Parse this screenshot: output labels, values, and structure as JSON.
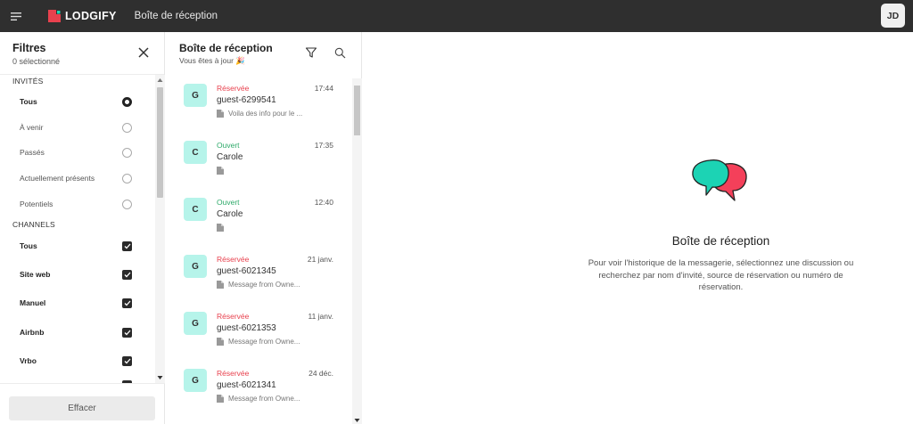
{
  "header": {
    "brand": "LODGIFY",
    "page_title": "Boîte de réception",
    "user_initials": "JD"
  },
  "colors": {
    "topbar": "#2f2f2f",
    "brand_red": "#e8414e",
    "brand_teal": "#1cd3b4",
    "status_reserved": "#e8414e",
    "status_open": "#2eaa6a",
    "avatar_bg": "#b6f4ea"
  },
  "filters": {
    "title": "Filtres",
    "selected_count": "0 sélectionné",
    "guests_section": "INVITÉS",
    "guests": [
      {
        "label": "Tous",
        "selected": true
      },
      {
        "label": "À venir",
        "selected": false
      },
      {
        "label": "Passés",
        "selected": false
      },
      {
        "label": "Actuellement présents",
        "selected": false
      },
      {
        "label": "Potentiels",
        "selected": false
      }
    ],
    "channels_section": "CHANNELS",
    "channels": [
      {
        "label": "Tous",
        "checked": true
      },
      {
        "label": "Site web",
        "checked": true
      },
      {
        "label": "Manuel",
        "checked": true
      },
      {
        "label": "Airbnb",
        "checked": true
      },
      {
        "label": "Vrbo",
        "checked": true
      }
    ],
    "clear_button": "Effacer"
  },
  "inbox": {
    "title": "Boîte de réception",
    "subtitle": "Vous êtes à jour 🎉",
    "conversations": [
      {
        "initial": "G",
        "status": "Réservée",
        "status_type": "reserved",
        "time": "17:44",
        "name": "guest-6299541",
        "preview": "Voila des info pour le ..."
      },
      {
        "initial": "C",
        "status": "Ouvert",
        "status_type": "open",
        "time": "17:35",
        "name": "Carole",
        "preview": ""
      },
      {
        "initial": "C",
        "status": "Ouvert",
        "status_type": "open",
        "time": "12:40",
        "name": "Carole",
        "preview": ""
      },
      {
        "initial": "G",
        "status": "Réservée",
        "status_type": "reserved",
        "time": "21 janv.",
        "name": "guest-6021345",
        "preview": "Message from Owne..."
      },
      {
        "initial": "G",
        "status": "Réservée",
        "status_type": "reserved",
        "time": "11 janv.",
        "name": "guest-6021353",
        "preview": "Message from Owne..."
      },
      {
        "initial": "G",
        "status": "Réservée",
        "status_type": "reserved",
        "time": "24 déc.",
        "name": "guest-6021341",
        "preview": "Message from Owne..."
      }
    ]
  },
  "empty_state": {
    "title": "Boîte de réception",
    "description": "Pour voir l'historique de la messagerie, sélectionnez une discussion ou recherchez par nom d'invité, source de réservation ou numéro de réservation."
  }
}
